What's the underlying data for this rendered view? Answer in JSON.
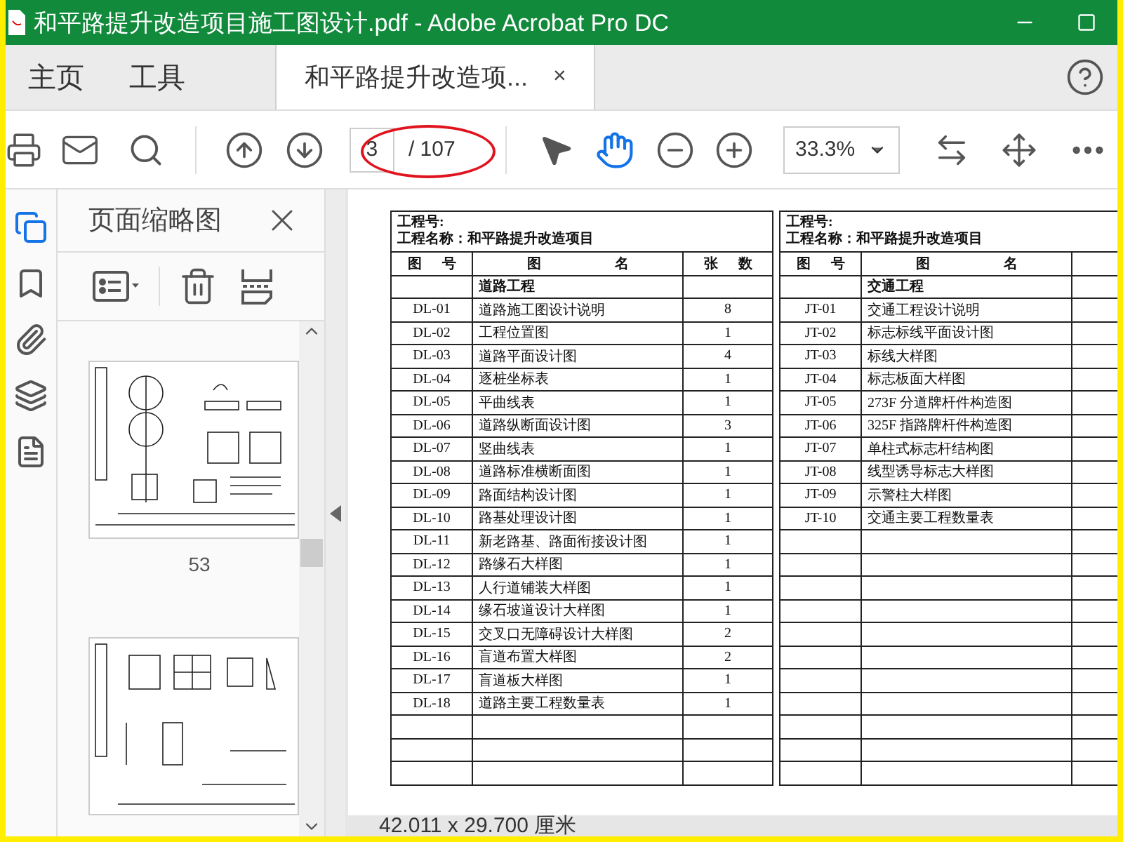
{
  "window": {
    "title": "和平路提升改造项目施工图设计.pdf - Adobe Acrobat Pro DC"
  },
  "nav_tabs": [
    {
      "label": "主页",
      "selected": false
    },
    {
      "label": "工具",
      "selected": false
    },
    {
      "label": "和平路提升改造项...",
      "selected": true,
      "close": "×"
    }
  ],
  "toolbar": {
    "page_input": "3",
    "page_total": "/ 107",
    "zoom": "33.3%",
    "hand_tool_selected": true
  },
  "thumbnails_panel": {
    "title": "页面缩略图",
    "thumbnails": [
      {
        "kind": "sign-post",
        "label": "53"
      },
      {
        "kind": "frames"
      }
    ]
  },
  "document": {
    "tables": [
      {
        "project_no": "工程号:",
        "project_name": "工程名称：和平路提升改造项目",
        "columns": [
          "图 号",
          "图 名",
          "张 数"
        ],
        "rows": [
          {
            "kind": "category",
            "name": "道路工程"
          },
          {
            "kind": "entry",
            "code": "DL-01",
            "name": "道路施工图设计说明",
            "count": "8"
          },
          {
            "kind": "entry",
            "code": "DL-02",
            "name": "工程位置图",
            "count": "1"
          },
          {
            "kind": "entry",
            "code": "DL-03",
            "name": "道路平面设计图",
            "count": "4"
          },
          {
            "kind": "entry",
            "code": "DL-04",
            "name": "逐桩坐标表",
            "count": "1"
          },
          {
            "kind": "entry",
            "code": "DL-05",
            "name": "平曲线表",
            "count": "1"
          },
          {
            "kind": "entry",
            "code": "DL-06",
            "name": "道路纵断面设计图",
            "count": "3"
          },
          {
            "kind": "entry",
            "code": "DL-07",
            "name": "竖曲线表",
            "count": "1"
          },
          {
            "kind": "entry",
            "code": "DL-08",
            "name": "道路标准横断面图",
            "count": "1"
          },
          {
            "kind": "entry",
            "code": "DL-09",
            "name": "路面结构设计图",
            "count": "1"
          },
          {
            "kind": "entry",
            "code": "DL-10",
            "name": "路基处理设计图",
            "count": "1"
          },
          {
            "kind": "entry",
            "code": "DL-11",
            "name": "新老路基、路面衔接设计图",
            "count": "1"
          },
          {
            "kind": "entry",
            "code": "DL-12",
            "name": "路缘石大样图",
            "count": "1"
          },
          {
            "kind": "entry",
            "code": "DL-13",
            "name": "人行道铺装大样图",
            "count": "1"
          },
          {
            "kind": "entry",
            "code": "DL-14",
            "name": "缘石坡道设计大样图",
            "count": "1"
          },
          {
            "kind": "entry",
            "code": "DL-15",
            "name": "交叉口无障碍设计大样图",
            "count": "2"
          },
          {
            "kind": "entry",
            "code": "DL-16",
            "name": "盲道布置大样图",
            "count": "2"
          },
          {
            "kind": "entry",
            "code": "DL-17",
            "name": "盲道板大样图",
            "count": "1"
          },
          {
            "kind": "entry",
            "code": "DL-18",
            "name": "道路主要工程数量表",
            "count": "1"
          },
          {
            "kind": "blank"
          },
          {
            "kind": "blank"
          },
          {
            "kind": "blank"
          }
        ]
      },
      {
        "project_no": "工程号:",
        "project_name": "工程名称：和平路提升改造项目",
        "columns": [
          "图 号",
          "图 名"
        ],
        "rows": [
          {
            "kind": "category",
            "name": "交通工程"
          },
          {
            "kind": "entry",
            "code": "JT-01",
            "name": "交通工程设计说明"
          },
          {
            "kind": "entry",
            "code": "JT-02",
            "name": "标志标线平面设计图"
          },
          {
            "kind": "entry",
            "code": "JT-03",
            "name": "标线大样图"
          },
          {
            "kind": "entry",
            "code": "JT-04",
            "name": "标志板面大样图"
          },
          {
            "kind": "entry",
            "code": "JT-05",
            "name": "273F 分道牌杆件构造图"
          },
          {
            "kind": "entry",
            "code": "JT-06",
            "name": "325F 指路牌杆件构造图"
          },
          {
            "kind": "entry",
            "code": "JT-07",
            "name": "单柱式标志杆结构图"
          },
          {
            "kind": "entry",
            "code": "JT-08",
            "name": "线型诱导标志大样图"
          },
          {
            "kind": "entry",
            "code": "JT-09",
            "name": "示警柱大样图"
          },
          {
            "kind": "entry",
            "code": "JT-10",
            "name": "交通主要工程数量表"
          },
          {
            "kind": "blank"
          },
          {
            "kind": "blank"
          },
          {
            "kind": "blank"
          },
          {
            "kind": "blank"
          },
          {
            "kind": "blank"
          },
          {
            "kind": "blank"
          },
          {
            "kind": "blank"
          },
          {
            "kind": "blank"
          },
          {
            "kind": "blank"
          },
          {
            "kind": "blank"
          },
          {
            "kind": "blank"
          }
        ]
      }
    ]
  },
  "status_bar": {
    "page_size": "42.011 x 29.700 厘米"
  }
}
